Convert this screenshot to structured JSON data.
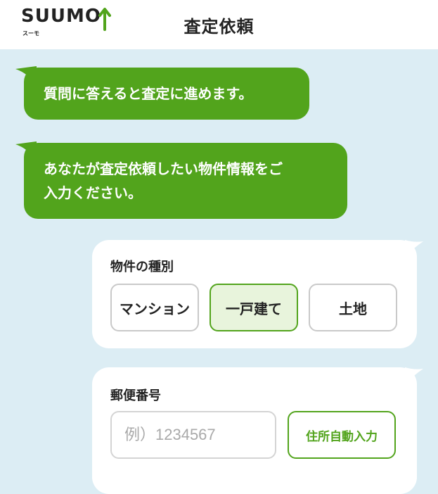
{
  "header": {
    "logo_text": "SUUMO",
    "logo_subtext": "スーモ",
    "title": "査定依頼"
  },
  "messages": [
    {
      "text": "質問に答えると査定に進めます。"
    },
    {
      "line1": "あなたが査定依頼したい物件情報をご",
      "line2": "入力ください。"
    }
  ],
  "property_type": {
    "label": "物件の種別",
    "options": [
      "マンション",
      "一戸建て",
      "土地"
    ],
    "selected": "一戸建て"
  },
  "postal_code": {
    "label": "郵便番号",
    "value": "",
    "placeholder": "例）1234567",
    "auto_fill_label": "住所自動入力"
  },
  "colors": {
    "brand_green": "#52a41c",
    "background": "#dcedf4",
    "selected_fill": "#e8f4dc"
  }
}
